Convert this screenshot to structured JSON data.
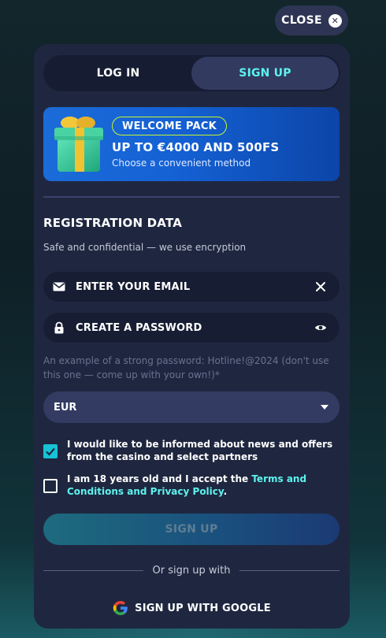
{
  "header": {
    "close_label": "CLOSE"
  },
  "tabs": [
    {
      "label": "LOG IN",
      "active": false
    },
    {
      "label": "SIGN UP",
      "active": true
    }
  ],
  "banner": {
    "badge": "WELCOME PACK",
    "title": "UP TO €4000 AND 500FS",
    "subtitle": "Choose a convenient method"
  },
  "form": {
    "section_title": "REGISTRATION DATA",
    "section_subtitle": "Safe and confidential — we use encryption",
    "email_placeholder": "ENTER YOUR EMAIL",
    "password_placeholder": "CREATE A PASSWORD",
    "password_hint": "An example of a strong password: Hotline!@2024 (don't use this one — come up with your own!)*",
    "currency": "EUR",
    "news_consent": {
      "label": "I would like to be informed about news and offers from the casino and select partners",
      "checked": true
    },
    "terms_consent": {
      "label_prefix": "I am 18 years old and I accept the ",
      "link_text": "Terms and Conditions and Privacy Policy",
      "label_suffix": ".",
      "checked": false
    },
    "submit_label": "SIGN UP"
  },
  "social": {
    "divider_text": "Or sign up with",
    "google_label": "SIGN UP WITH GOOGLE"
  },
  "colors": {
    "accent": "#5ef3ee",
    "modal_bg": "#1f2740",
    "checkbox_on": "#16c3d6",
    "badge_border": "#c8f531"
  }
}
